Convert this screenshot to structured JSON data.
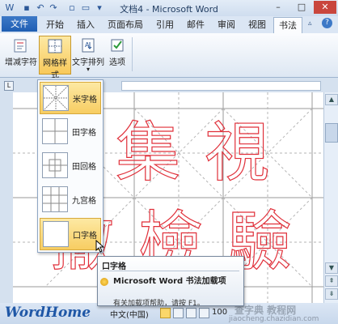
{
  "window": {
    "title": "文档4 - Microsoft Word",
    "minimize": "–",
    "maximize": "□",
    "close": "✕"
  },
  "tabs": {
    "file": "文件",
    "items": [
      "开始",
      "插入",
      "页面布局",
      "引用",
      "邮件",
      "审阅",
      "视图",
      "书法"
    ]
  },
  "ribbon": {
    "buttons": [
      "增减字符",
      "网格样式",
      "文字排列",
      "选项"
    ],
    "dropdown_arrow": "▾"
  },
  "grid_styles": [
    "米字格",
    "田字格",
    "田回格",
    "九宫格",
    "口字格"
  ],
  "calligraphy_chars": {
    "row1": [
      "集",
      "視"
    ],
    "row2": [
      "撤",
      "檢",
      "驗"
    ]
  },
  "tooltip": {
    "title": "口字格",
    "heading": "Microsoft Word 书法加载项",
    "help": "有关加载项帮助，请按 F1。"
  },
  "status": {
    "language": "中文(中国)",
    "zoom": "100"
  },
  "watermark": {
    "brand": "WordHome",
    "site": "查字典 教程网",
    "url": "jiaocheng.chazidian.com"
  },
  "colors": {
    "accent_file": "#2b67ba",
    "selection": "#f8c95b",
    "char_outline": "#e0303a"
  }
}
